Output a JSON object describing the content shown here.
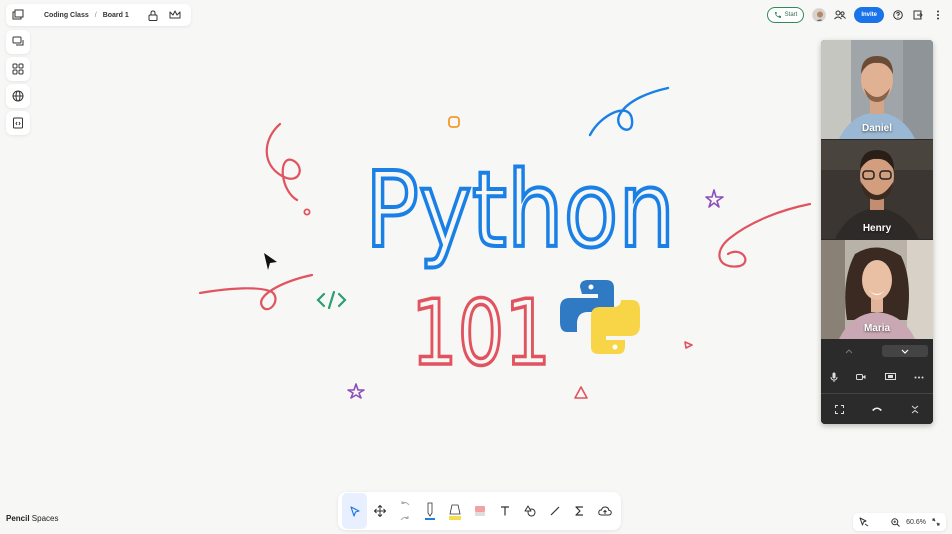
{
  "breadcrumb": {
    "class_name": "Coding Class",
    "separator": "/",
    "board_name": "Board 1"
  },
  "topbar": {
    "start_label": "Start",
    "invite_label": "Invite"
  },
  "board": {
    "title_text": "Python",
    "subtitle_text": "101",
    "colors": {
      "blue": "#1a80e5",
      "red": "#e0535f",
      "orange": "#f39a2b",
      "purple": "#8c4fb8",
      "green": "#2e9e6e"
    }
  },
  "participants": [
    {
      "name": "Daniel"
    },
    {
      "name": "Henry"
    },
    {
      "name": "Maria"
    }
  ],
  "brand": {
    "bold": "Pencil",
    "light": " Spaces"
  },
  "zoom": {
    "level": "60.6%"
  },
  "colors": {
    "accent": "#1a73e8",
    "call_green": "#2e8b57"
  }
}
